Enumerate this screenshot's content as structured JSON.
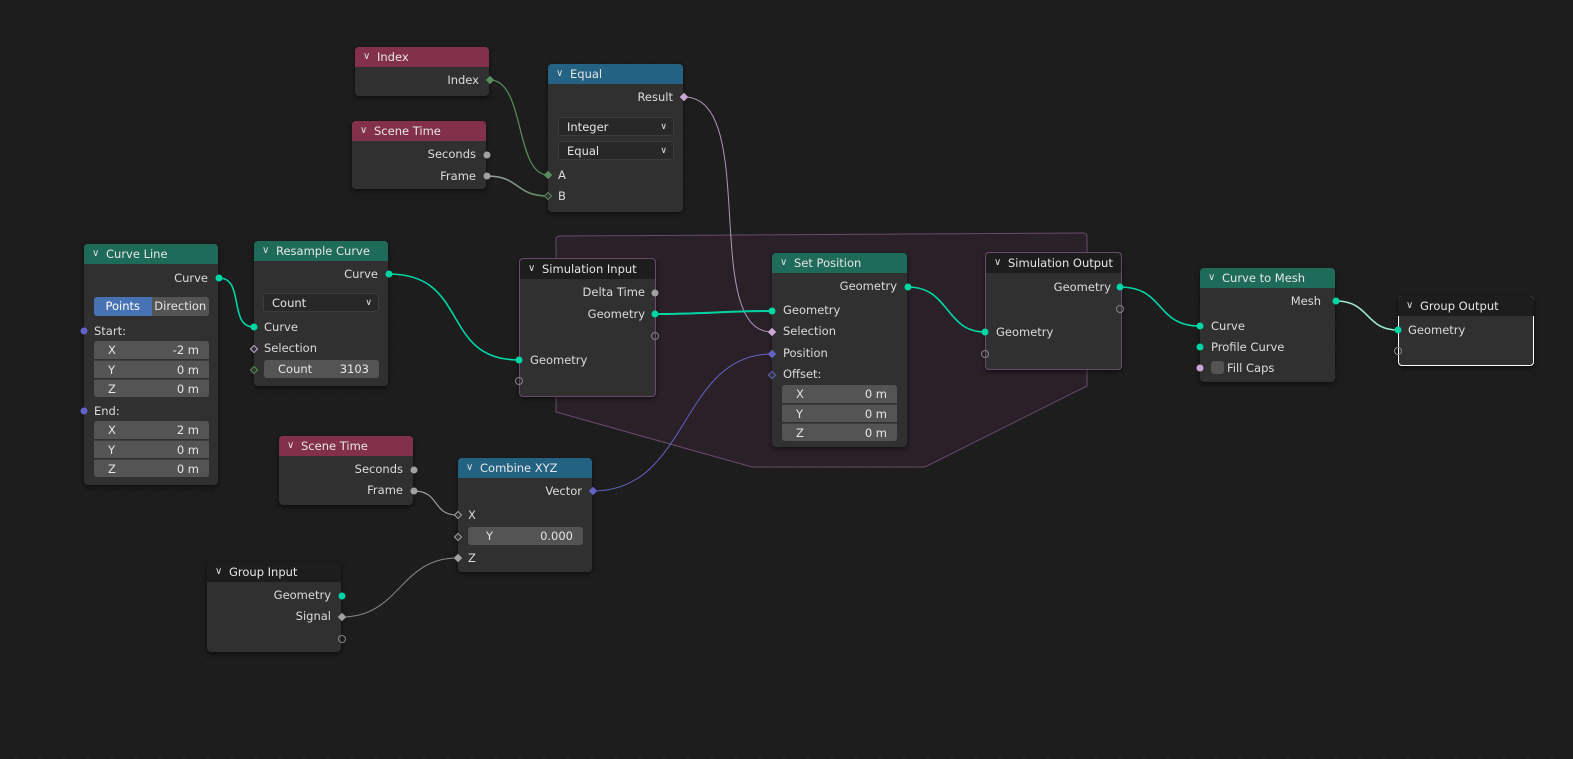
{
  "editor": "Geometry Node Editor",
  "colors": {
    "background": "#1d1d1d",
    "input_header": "#83314a",
    "geometry_header": "#1e6b5a",
    "converter_header": "#246283",
    "dark_header": "#1d1d1d",
    "node_body": "#303030",
    "geometry_socket": "#00d6a3",
    "float_socket": "#a1a1a1",
    "vector_socket": "#6363c7",
    "integer_socket": "#598c5c",
    "boolean_socket": "#cca6d6",
    "simulation_zone": "#2a2128",
    "active_toggle": "#4772b3"
  },
  "icons": {
    "collapse": "chevron-down-icon"
  },
  "nodes": {
    "index": {
      "title": "Index",
      "outputs": [
        "Index"
      ]
    },
    "scene_time_top": {
      "title": "Scene Time",
      "outputs": [
        "Seconds",
        "Frame"
      ]
    },
    "equal": {
      "title": "Equal",
      "outputs": [
        "Result"
      ],
      "data_type": "Integer",
      "operation": "Equal",
      "inputs": [
        "A",
        "B"
      ]
    },
    "curve_line": {
      "title": "Curve Line",
      "outputs": [
        "Curve"
      ],
      "mode_options": [
        "Points",
        "Direction"
      ],
      "mode_selected": "Points",
      "start_label": "Start:",
      "start": [
        {
          "axis": "X",
          "value": "-2 m"
        },
        {
          "axis": "Y",
          "value": "0 m"
        },
        {
          "axis": "Z",
          "value": "0 m"
        }
      ],
      "end_label": "End:",
      "end": [
        {
          "axis": "X",
          "value": "2 m"
        },
        {
          "axis": "Y",
          "value": "0 m"
        },
        {
          "axis": "Z",
          "value": "0 m"
        }
      ]
    },
    "resample_curve": {
      "title": "Resample Curve",
      "outputs": [
        "Curve"
      ],
      "mode": "Count",
      "inputs": [
        "Curve",
        "Selection"
      ],
      "count_label": "Count",
      "count_value": "3103"
    },
    "simulation_input": {
      "title": "Simulation Input",
      "outputs": [
        "Delta Time",
        "Geometry"
      ],
      "inputs": [
        "Geometry"
      ]
    },
    "set_position": {
      "title": "Set Position",
      "outputs": [
        "Geometry"
      ],
      "inputs": [
        "Geometry",
        "Selection",
        "Position",
        "Offset:"
      ],
      "offset": [
        {
          "axis": "X",
          "value": "0 m"
        },
        {
          "axis": "Y",
          "value": "0 m"
        },
        {
          "axis": "Z",
          "value": "0 m"
        }
      ]
    },
    "simulation_output": {
      "title": "Simulation Output",
      "outputs": [
        "Geometry"
      ],
      "inputs": [
        "Geometry"
      ]
    },
    "curve_to_mesh": {
      "title": "Curve to Mesh",
      "outputs": [
        "Mesh"
      ],
      "inputs": [
        "Curve",
        "Profile Curve"
      ],
      "fill_caps_label": "Fill Caps",
      "fill_caps_checked": false
    },
    "group_output": {
      "title": "Group Output",
      "inputs": [
        "Geometry"
      ]
    },
    "scene_time_bottom": {
      "title": "Scene Time",
      "outputs": [
        "Seconds",
        "Frame"
      ]
    },
    "combine_xyz": {
      "title": "Combine XYZ",
      "outputs": [
        "Vector"
      ],
      "inputs": [
        "X",
        "Z"
      ],
      "y_label": "Y",
      "y_value": "0.000"
    },
    "group_input": {
      "title": "Group Input",
      "outputs": [
        "Geometry",
        "Signal"
      ]
    }
  }
}
